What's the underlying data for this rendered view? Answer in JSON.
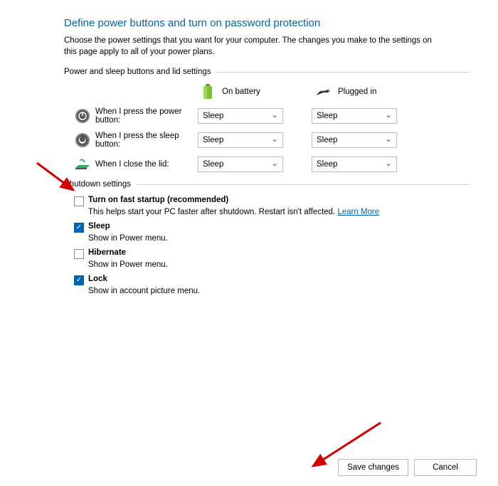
{
  "title": "Define power buttons and turn on password protection",
  "description": "Choose the power settings that you want for your computer. The changes you make to the settings on this page apply to all of your power plans.",
  "section_power_sleep": "Power and sleep buttons and lid settings",
  "col_battery": "On battery",
  "col_plugged": "Plugged in",
  "rows": {
    "power_button": {
      "label": "When I press the power button:",
      "battery": "Sleep",
      "plugged": "Sleep"
    },
    "sleep_button": {
      "label": "When I press the sleep button:",
      "battery": "Sleep",
      "plugged": "Sleep"
    },
    "close_lid": {
      "label": "When I close the lid:",
      "battery": "Sleep",
      "plugged": "Sleep"
    }
  },
  "section_shutdown": "Shutdown settings",
  "shutdown": {
    "fast_startup": {
      "label": "Turn on fast startup (recommended)",
      "sub": "This helps start your PC faster after shutdown. Restart isn't affected. ",
      "learn_more": "Learn More",
      "checked": false
    },
    "sleep": {
      "label": "Sleep",
      "sub": "Show in Power menu.",
      "checked": true
    },
    "hibernate": {
      "label": "Hibernate",
      "sub": "Show in Power menu.",
      "checked": false
    },
    "lock": {
      "label": "Lock",
      "sub": "Show in account picture menu.",
      "checked": true
    }
  },
  "buttons": {
    "save": "Save changes",
    "cancel": "Cancel"
  }
}
